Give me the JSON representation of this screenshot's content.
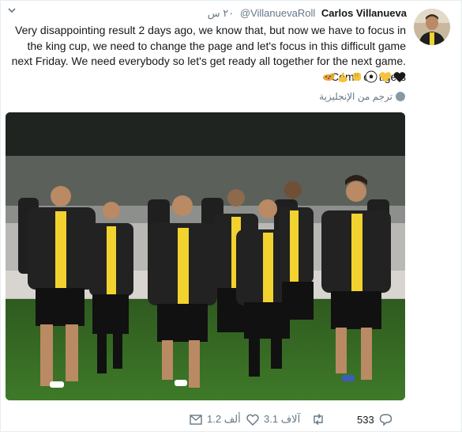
{
  "tweet": {
    "author_name": "Carlos Villanueva",
    "handle": "@VillanuevaRoll",
    "time": "٢٠ س",
    "text": "Very disappointing result 2 days ago, we know that, but now we have to focus in the king cup, we need to change the page and let's focus in this difficult game next Friday. We need everybody so let's get ready all together for the next game. Come on tigers",
    "emojis": [
      "leopard-icon",
      "flexed-biceps-icon",
      "fist-bump-icon",
      "soccer-ball-icon",
      "yellow-heart-icon",
      "black-heart-icon"
    ],
    "translate_label": "ترجم من الإنجليزية"
  },
  "actions": {
    "replies": "533",
    "retweets": "",
    "retweets_label": "",
    "likes": "3.1 آلاف",
    "messages": "1.2 ألف"
  },
  "colors": {
    "text": "#14171a",
    "secondary": "#657786",
    "border": "#e6ecf0",
    "kit_black": "#1f1f1f",
    "kit_yellow": "#f2d22e"
  }
}
